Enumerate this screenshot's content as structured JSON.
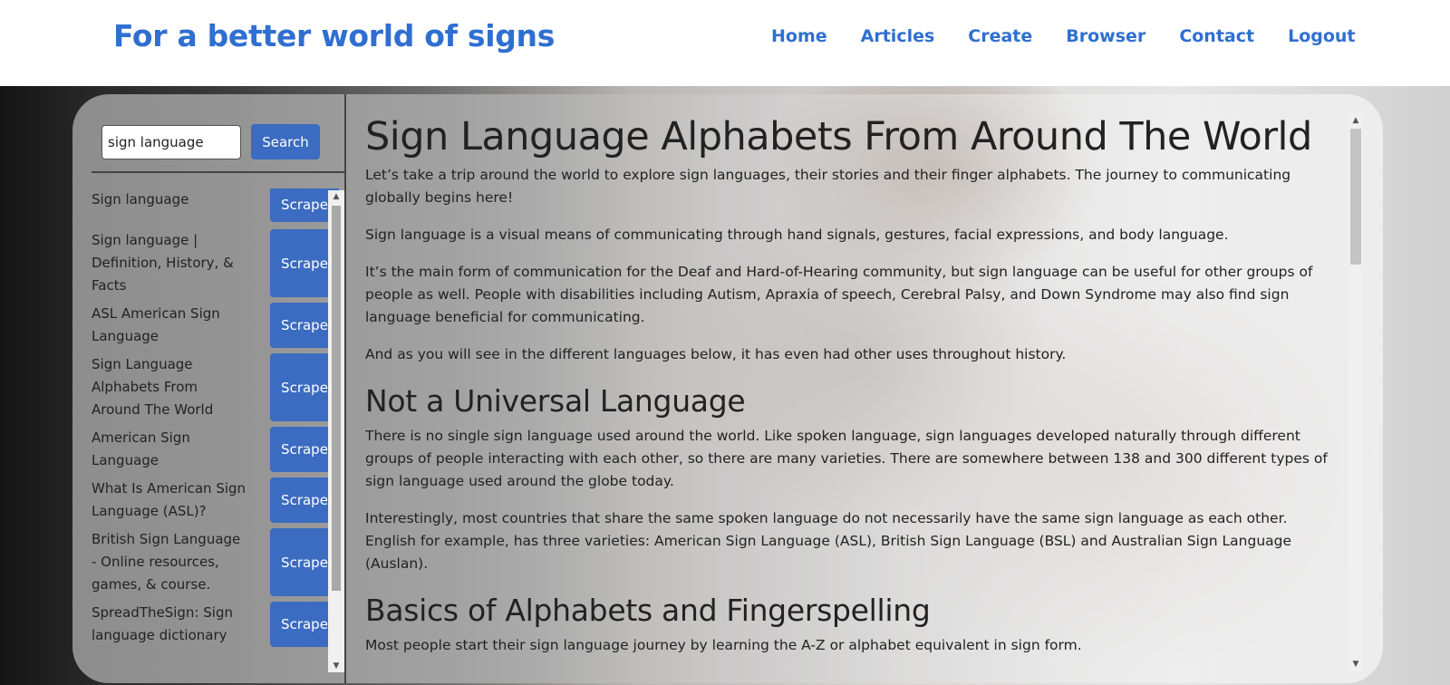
{
  "header": {
    "brand": "For a better world of signs",
    "nav": [
      "Home",
      "Articles",
      "Create",
      "Browser",
      "Contact",
      "Logout"
    ]
  },
  "search": {
    "value": "sign language",
    "button_label": "Search"
  },
  "results": [
    {
      "title": "Sign language",
      "button": "Scrape"
    },
    {
      "title": "Sign language | Definition, History, & Facts",
      "button": "Scrape"
    },
    {
      "title": "ASL American Sign Language",
      "button": "Scrape"
    },
    {
      "title": "Sign Language Alphabets From Around The World",
      "button": "Scrape"
    },
    {
      "title": "American Sign Language",
      "button": "Scrape"
    },
    {
      "title": "What Is American Sign Language (ASL)?",
      "button": "Scrape"
    },
    {
      "title": "British Sign Language - Online resources, games, & course.",
      "button": "Scrape"
    },
    {
      "title": "SpreadTheSign: Sign language dictionary",
      "button": "Scrape"
    }
  ],
  "article": {
    "title": "Sign Language Alphabets From Around The World",
    "intro": [
      "Let’s take a trip around the world to explore sign languages, their stories and their finger alphabets. The journey to communicating globally begins here!",
      "Sign language is a visual means of communicating through hand signals, gestures, facial expressions, and body language.",
      "It’s the main form of communication for the Deaf and Hard-of-Hearing community, but sign language can be useful for other groups of people as well. People with disabilities including Autism, Apraxia of speech, Cerebral Palsy, and Down Syndrome may also find sign language beneficial for communicating.",
      "And as you will see in the different languages below, it has even had other uses throughout history."
    ],
    "section1_heading": "Not a Universal Language",
    "section1": [
      "There is no single sign language used around the world. Like spoken language, sign languages developed naturally through different groups of people interacting with each other, so there are many varieties. There are somewhere between 138 and 300 different types of sign language used around the globe today.",
      "Interestingly, most countries that share the same spoken language do not necessarily have the same sign language as each other. English for example, has three varieties: American Sign Language (ASL), British Sign Language (BSL) and Australian Sign Language (Auslan)."
    ],
    "section2_heading": "Basics of Alphabets and Fingerspelling",
    "section2": [
      "Most people start their sign language journey by learning the A-Z or alphabet equivalent in sign form."
    ]
  },
  "colors": {
    "brand": "#2f6fd1",
    "button": "#3b6cc1"
  }
}
